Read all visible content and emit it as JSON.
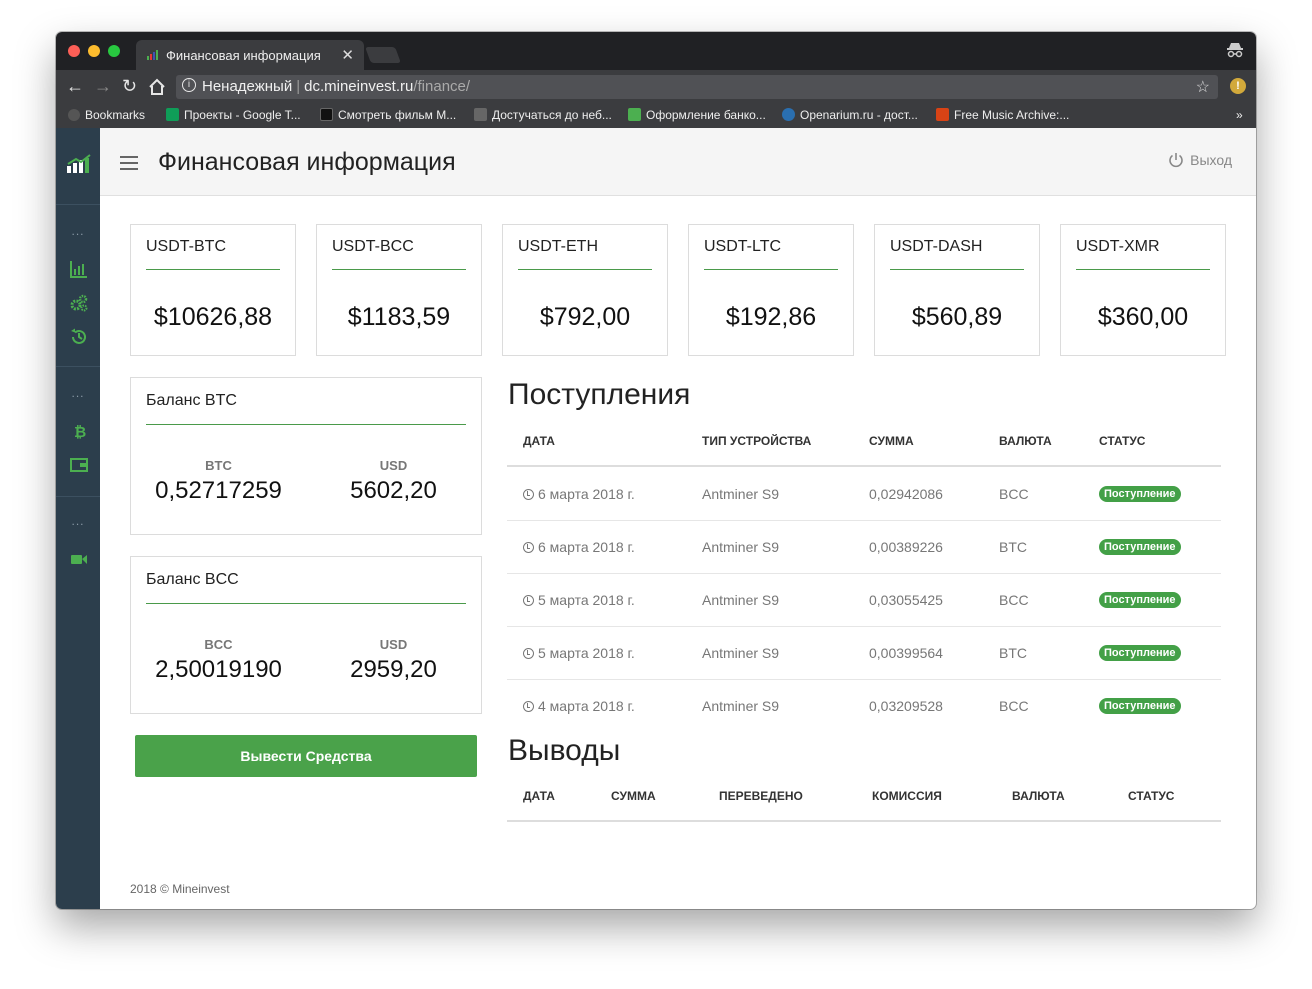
{
  "browser": {
    "tab_title": "Финансовая информация",
    "tab_close": "✕",
    "security_label": "Ненадежный",
    "url_host": "dc.mineinvest.ru",
    "url_path": "/finance/",
    "bookmarks": [
      "Bookmarks",
      "Проекты - Google T...",
      "Смотреть фильм M...",
      "Достучаться до неб...",
      "Оформление банко...",
      "Openarium.ru - дост...",
      "Free Music Archive:..."
    ],
    "bookmarks_more": "»"
  },
  "header": {
    "title": "Финансовая информация",
    "logout_label": "Выход"
  },
  "sidebar": {
    "dots": "...",
    "icons": [
      "chart-icon",
      "gears-icon",
      "history-icon",
      "bitcoin-icon",
      "wallet-icon",
      "video-icon"
    ]
  },
  "tickers": [
    {
      "label": "USDT-BTC",
      "value": "$10626,88"
    },
    {
      "label": "USDT-BCC",
      "value": "$1183,59"
    },
    {
      "label": "USDT-ETH",
      "value": "$792,00"
    },
    {
      "label": "USDT-LTC",
      "value": "$192,86"
    },
    {
      "label": "USDT-DASH",
      "value": "$560,89"
    },
    {
      "label": "USDT-XMR",
      "value": "$360,00"
    }
  ],
  "balances": [
    {
      "title": "Баланс BTC",
      "currency": "BTC",
      "amount": "0,52717259",
      "usd_label": "USD",
      "usd": "5602,20"
    },
    {
      "title": "Баланс BCC",
      "currency": "BCC",
      "amount": "2,50019190",
      "usd_label": "USD",
      "usd": "2959,20"
    }
  ],
  "withdraw_button": "Вывести Средства",
  "income": {
    "title": "Поступления",
    "columns": [
      "ДАТА",
      "ТИП УСТРОЙСТВА",
      "СУММА",
      "ВАЛЮТА",
      "СТАТУС"
    ],
    "rows": [
      {
        "date": "6 марта 2018 г.",
        "device": "Antminer S9",
        "amount": "0,02942086",
        "currency": "BCC",
        "status": "Поступление"
      },
      {
        "date": "6 марта 2018 г.",
        "device": "Antminer S9",
        "amount": "0,00389226",
        "currency": "BTC",
        "status": "Поступление"
      },
      {
        "date": "5 марта 2018 г.",
        "device": "Antminer S9",
        "amount": "0,03055425",
        "currency": "BCC",
        "status": "Поступление"
      },
      {
        "date": "5 марта 2018 г.",
        "device": "Antminer S9",
        "amount": "0,00399564",
        "currency": "BTC",
        "status": "Поступление"
      },
      {
        "date": "4 марта 2018 г.",
        "device": "Antminer S9",
        "amount": "0,03209528",
        "currency": "BCC",
        "status": "Поступление"
      }
    ]
  },
  "withdrawals": {
    "title": "Выводы",
    "columns": [
      "ДАТА",
      "СУММА",
      "ПЕРЕВЕДЕНО",
      "КОМИССИЯ",
      "ВАЛЮТА",
      "СТАТУС"
    ]
  },
  "footer": "2018 © Mineinvest",
  "colors": {
    "accent_green": "#4aa24a",
    "sidebar_bg": "#2c3e4c",
    "badge_green": "#43a047"
  }
}
